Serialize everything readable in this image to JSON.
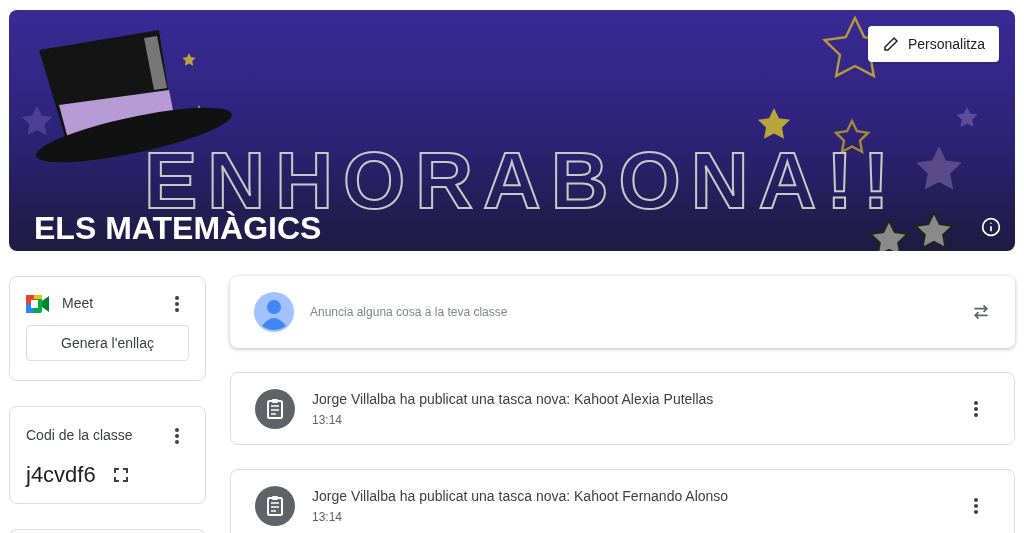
{
  "banner": {
    "artwork_text": "ENHORABONA!!",
    "class_name": "ELS MATEMÀGICS",
    "customize_button": "Personalitza"
  },
  "meet": {
    "label": "Meet",
    "button": "Genera l'enllaç"
  },
  "class_code": {
    "label": "Codi de la classe",
    "code": "j4cvdf6"
  },
  "announce": {
    "placeholder": "Anuncia alguna cosa a la teva classe"
  },
  "posts": [
    {
      "title": "Jorge Villalba ha publicat una tasca nova: Kahoot Alexia Putellas",
      "time": "13:14"
    },
    {
      "title": "Jorge Villalba ha publicat una tasca nova: Kahoot Fernando Alonso",
      "time": "13:14"
    }
  ]
}
